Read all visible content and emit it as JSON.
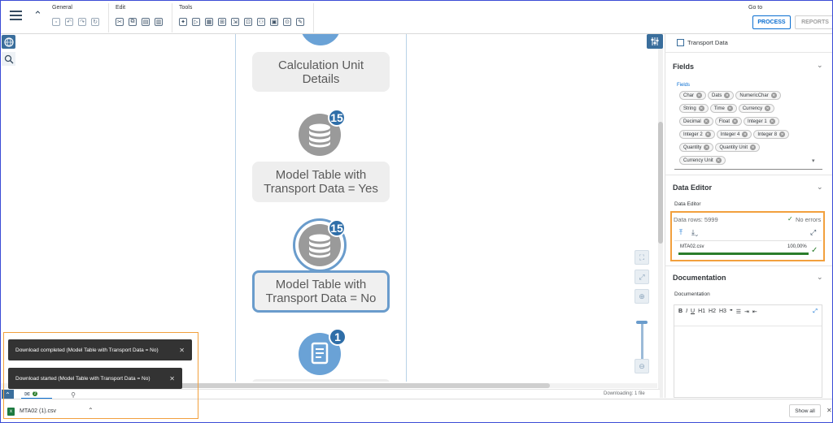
{
  "toolbar": {
    "groups": [
      {
        "label": "General"
      },
      {
        "label": "Edit"
      },
      {
        "label": "Tools"
      }
    ],
    "goto_label": "Go to",
    "process_label": "PROCESS",
    "reports_label": "REPORTS"
  },
  "canvas": {
    "node1_label_l1": "Calculation Unit",
    "node1_label_l2": "Details",
    "node2_badge": "15",
    "node2_label_l1": "Model Table with",
    "node2_label_l2": "Transport Data = Yes",
    "node3_badge": "15",
    "node3_label_l1": "Model Table with",
    "node3_label_l2": "Transport Data = No",
    "node4_badge": "1"
  },
  "panel": {
    "transport_data_label": "Transport Data",
    "fields_title": "Fields",
    "fields_sublabel": "Fields",
    "field_tokens": [
      "Char",
      "Dats",
      "NumericChar",
      "String",
      "Time",
      "Currency",
      "Decimal",
      "Float",
      "Integer 1",
      "Integer 2",
      "Integer 4",
      "Integer 8",
      "Quantity",
      "Quantity Unit",
      "Currency Unit"
    ],
    "data_editor_title": "Data Editor",
    "data_editor_sublabel": "Data Editor",
    "data_rows": "Data rows: 5999",
    "no_errors": "No errors",
    "file_name": "MTA02.csv",
    "file_progress_text": "100,00%",
    "file_progress": 1.0,
    "documentation_title": "Documentation",
    "documentation_sublabel": "Documentation",
    "rte_buttons": [
      "B",
      "I",
      "U",
      "H1",
      "H2",
      "H3"
    ]
  },
  "status": {
    "downloading": "Downloading: 1 file",
    "tab_badge": "2"
  },
  "toasts": [
    {
      "text": "Download completed (Model Table with Transport Data = No)"
    },
    {
      "text": "Download started (Model Table with Transport Data = No)"
    }
  ],
  "downloads": {
    "file_name": "MTA02 (1).csv",
    "show_all": "Show all"
  },
  "colors": {
    "accent": "#0a6ed1",
    "node_blue": "#6aa2d6",
    "badge_blue": "#2f6ea8",
    "highlight_orange": "#f2a03d",
    "success_green": "#2b7d2b"
  }
}
